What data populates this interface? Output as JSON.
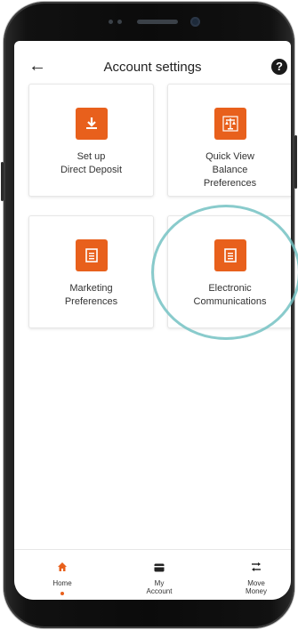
{
  "header": {
    "title": "Account settings",
    "back_icon": "arrow-left-icon",
    "help_icon": "question-circle-icon",
    "help_glyph": "?"
  },
  "cards": [
    {
      "label_line1": "Set up",
      "label_line2": "Direct Deposit",
      "label_line3": "",
      "icon": "download-icon"
    },
    {
      "label_line1": "Quick View",
      "label_line2": "Balance",
      "label_line3": "Preferences",
      "icon": "scale-icon"
    },
    {
      "label_line1": "Marketing",
      "label_line2": "Preferences",
      "label_line3": "",
      "icon": "document-icon"
    },
    {
      "label_line1": "Electronic",
      "label_line2": "Communications",
      "label_line3": "",
      "icon": "document-icon"
    }
  ],
  "tabs": [
    {
      "label": "Home",
      "icon": "home-icon",
      "active": true
    },
    {
      "label": "My Account",
      "icon": "card-icon",
      "active": false
    },
    {
      "label": "Move Money",
      "icon": "transfer-icon",
      "active": false
    }
  ],
  "colors": {
    "accent": "#e8601c",
    "highlight_circle": "#74c2c3"
  }
}
